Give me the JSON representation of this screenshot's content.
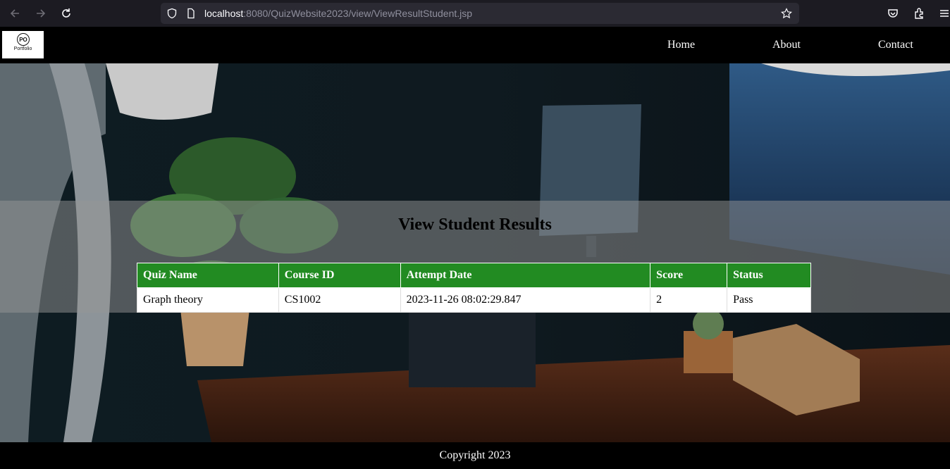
{
  "browser": {
    "url_host": "localhost",
    "url_path": ":8080/QuizWebsite2023/view/ViewResultStudent.jsp"
  },
  "header": {
    "logo_text": "Portfolio",
    "logo_mark": "PO",
    "nav": [
      "Home",
      "About",
      "Contact"
    ]
  },
  "main": {
    "title": "View Student Results",
    "columns": [
      "Quiz Name",
      "Course ID",
      "Attempt Date",
      "Score",
      "Status"
    ],
    "rows": [
      [
        "Graph theory",
        "CS1002",
        "2023-11-26 08:02:29.847",
        "2",
        "Pass"
      ]
    ]
  },
  "footer": {
    "copyright": "Copyright 2023"
  },
  "colors": {
    "table_header": "#228b22",
    "band": "rgba(150,150,150,0.5)"
  }
}
